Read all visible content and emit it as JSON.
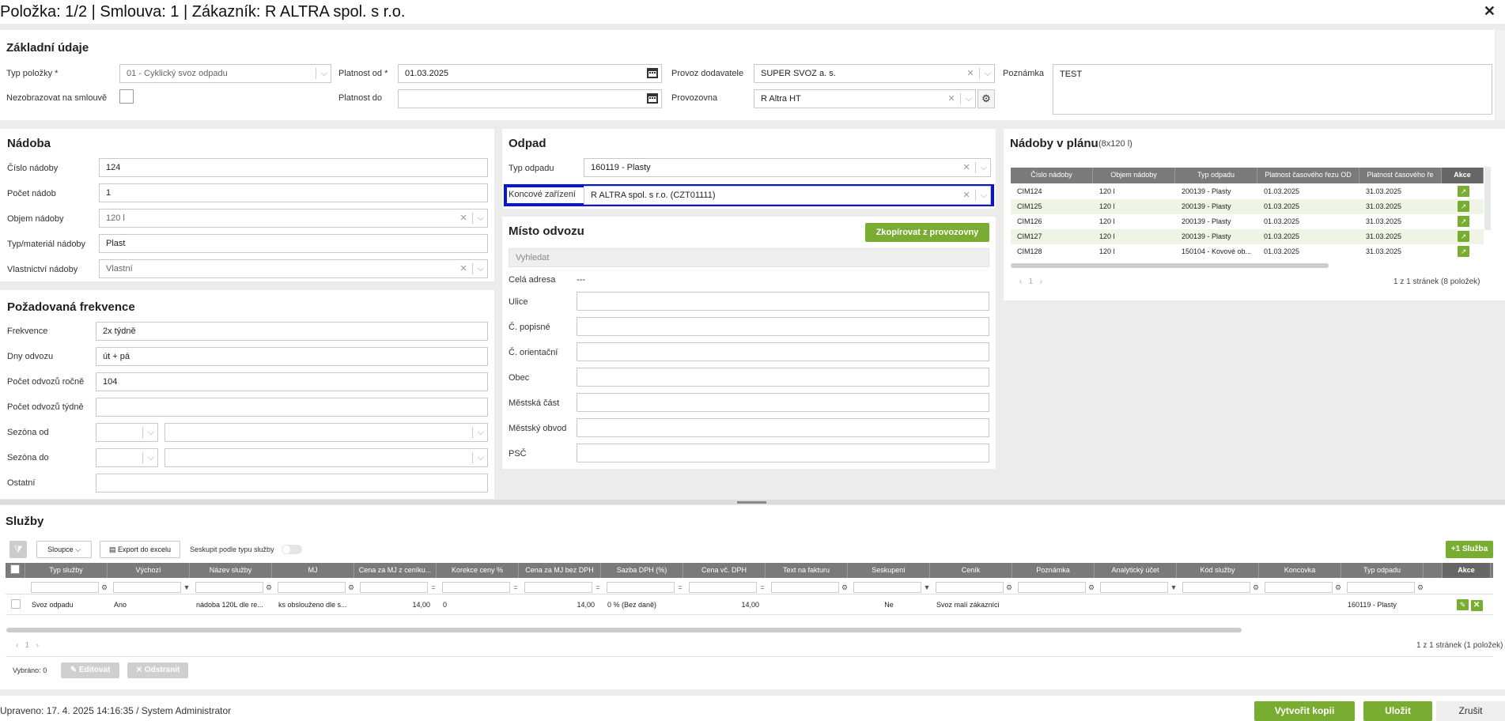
{
  "header": {
    "title": "Položka: 1/2 | Smlouva: 1 | Zákazník: R ALTRA spol. s r.o.",
    "close": "✕"
  },
  "basic": {
    "title": "Základní údaje",
    "typ_label": "Typ položky *",
    "typ_value": "01 - Cyklický svoz odpadu",
    "nezobr_label": "Nezobrazovat na smlouvě",
    "platnost_od_label": "Platnost od *",
    "platnost_od_value": "01.03.2025",
    "platnost_do_label": "Platnost do",
    "platnost_do_value": "",
    "provoz_label": "Provoz dodavatele",
    "provoz_value": "SUPER SVOZ a. s.",
    "provozovna_label": "Provozovna",
    "provozovna_value": "R Altra HT",
    "poznamka_label": "Poznámka",
    "poznamka_value": "TEST"
  },
  "nadoba": {
    "title": "Nádoba",
    "fields": [
      {
        "label": "Číslo nádoby",
        "value": "124"
      },
      {
        "label": "Počet nádob",
        "value": "1"
      },
      {
        "label": "Objem nádoby",
        "value": "120 l"
      },
      {
        "label": "Typ/materiál nádoby",
        "value": "Plast"
      },
      {
        "label": "Vlastnictví nádoby",
        "value": "Vlastní"
      }
    ]
  },
  "frekvence": {
    "title": "Požadovaná frekvence",
    "fields": [
      {
        "label": "Frekvence",
        "value": "2x týdně"
      },
      {
        "label": "Dny odvozu",
        "value": "út + pá"
      },
      {
        "label": "Počet odvozů ročně",
        "value": "104"
      },
      {
        "label": "Počet odvozů týdně",
        "value": ""
      },
      {
        "label": "Sezóna od",
        "value": ""
      },
      {
        "label": "Sezóna do",
        "value": ""
      },
      {
        "label": "Ostatní",
        "value": ""
      }
    ]
  },
  "odpad": {
    "title": "Odpad",
    "typ_label": "Typ odpadu",
    "typ_value": "160119 - Plasty",
    "koncove_label": "Koncové zařízení",
    "koncove_value": "R ALTRA spol. s r.o. (CZT01111)"
  },
  "misto": {
    "title": "Místo odvozu",
    "copy_button": "Zkopírovat z provozovny",
    "search_placeholder": "Vyhledat",
    "cela_label": "Celá adresa",
    "cela_value": "---",
    "fields": [
      "Ulice",
      "Č. popisné",
      "Č. orientační",
      "Obec",
      "Městská část",
      "Městský obvod",
      "PSČ"
    ]
  },
  "plan": {
    "title": "Nádoby v plánu",
    "subtitle": "(8x120 l)",
    "columns": [
      "Číslo nádoby",
      "Objem nádoby",
      "Typ odpadu",
      "Platnost časového řezu OD",
      "Platnost časového ře",
      "Akce"
    ],
    "rows": [
      [
        "CIM124",
        "120 l",
        "200139 - Plasty",
        "01.03.2025",
        "31.03.2025"
      ],
      [
        "CIM125",
        "120 l",
        "200139 - Plasty",
        "01.03.2025",
        "31.03.2025"
      ],
      [
        "CIM126",
        "120 l",
        "200139 - Plasty",
        "01.03.2025",
        "31.03.2025"
      ],
      [
        "CIM127",
        "120 l",
        "200139 - Plasty",
        "01.03.2025",
        "31.03.2025"
      ],
      [
        "CIM128",
        "120 l",
        "150104 - Kovové ob...",
        "01.03.2025",
        "31.03.2025"
      ]
    ],
    "pager_pages": "1",
    "pager_info": "1 z 1 stránek (8 položek)"
  },
  "sluzby": {
    "title": "Služby",
    "sloupce": "Sloupce",
    "export": "Export do excelu",
    "seskupit": "Seskupit podle typu služby",
    "add_button": "+1 Služba",
    "columns": [
      "Typ služby",
      "Výchozí",
      "Název služby",
      "MJ",
      "Cena za MJ z ceníku...",
      "Korekce ceny %",
      "Cena za MJ bez DPH",
      "Sazba DPH (%)",
      "Cena vč. DPH",
      "Text na fakturu",
      "Seskupení",
      "Ceník",
      "Poznámka",
      "Analytický účet",
      "Kód služby",
      "Koncovka",
      "Typ odpadu",
      "Akce"
    ],
    "row": [
      "Svoz odpadu",
      "Ano",
      "nádoba 120L dle re...",
      "ks obslouženo dle s...",
      "14,00",
      "0",
      "14,00",
      "0 % (Bez daně)",
      "14,00",
      "",
      "Ne",
      "Svoz malí zákazníci",
      "",
      "",
      "",
      "",
      "160119 - Plasty"
    ],
    "pager_pages": "1",
    "pager_info": "1 z 1 stránek (1 položek)",
    "vybrano": "Vybráno: 0",
    "edit": "Editovat",
    "remove": "Odstranit"
  },
  "footer": {
    "upraveno": "Upraveno: 17. 4. 2025 14:16:35 / System Administrator",
    "copy": "Vytvořit kopii",
    "save": "Uložit",
    "cancel": "Zrušit"
  },
  "colors": {
    "accent": "#79ad32",
    "highlight": "#0a14d6",
    "header_gray": "#7a7a7a"
  }
}
